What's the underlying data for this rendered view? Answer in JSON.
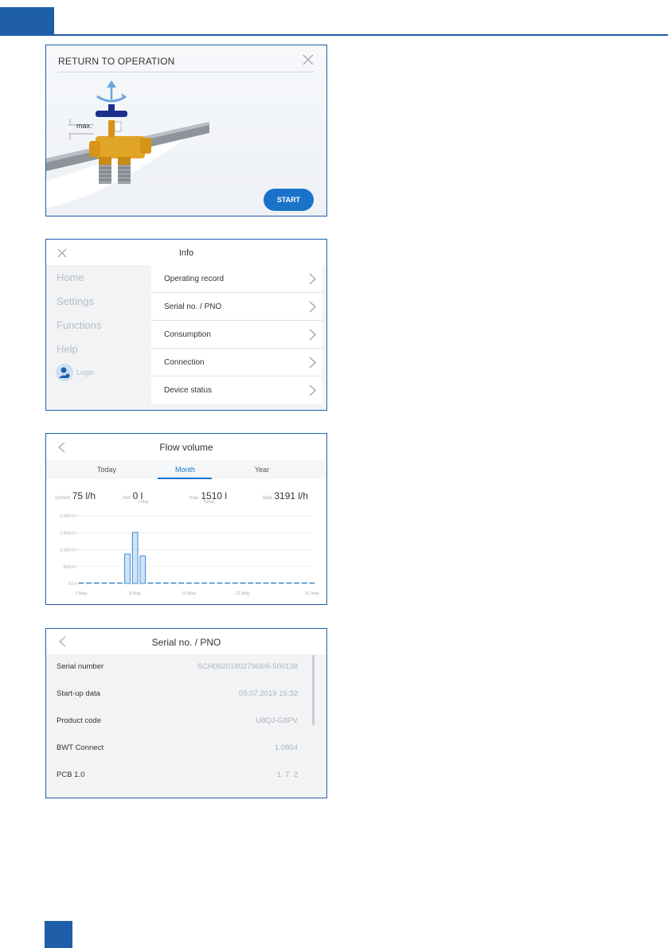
{
  "return_to_operation": {
    "title": "RETURN TO OPERATION",
    "max_label": "max.",
    "start_label": "START"
  },
  "info": {
    "title": "Info",
    "nav": [
      "Home",
      "Settings",
      "Functions",
      "Help"
    ],
    "login_label": "Login",
    "menu": [
      "Operating record",
      "Serial no. / PNO",
      "Consumption",
      "Connection",
      "Device status"
    ]
  },
  "flow": {
    "title": "Flow volume",
    "tabs": [
      "Today",
      "Month",
      "Year"
    ],
    "active_tab": "Month",
    "stats": {
      "current_label": "current",
      "current_value": "75 l/h",
      "min_label": "min",
      "min_value": "0 l",
      "min_date": "1.May",
      "max_label": "max",
      "max_value": "1510 l",
      "max_date": "8.May",
      "total_label": "total",
      "total_value": "3191 l/h"
    }
  },
  "chart_data": {
    "type": "bar",
    "x": [
      1,
      2,
      3,
      4,
      5,
      6,
      7,
      8,
      9,
      10,
      11,
      12,
      13,
      14,
      15,
      16,
      17,
      18,
      19,
      20,
      21,
      22,
      23,
      24,
      25,
      26,
      27,
      28,
      29,
      30,
      31
    ],
    "values": [
      0,
      0,
      0,
      0,
      0,
      0,
      870,
      1510,
      810,
      0,
      0,
      0,
      0,
      0,
      0,
      0,
      0,
      0,
      0,
      0,
      0,
      0,
      0,
      0,
      0,
      0,
      0,
      0,
      0,
      0,
      0
    ],
    "x_tick_labels": [
      "1.May",
      "8.May",
      "15.May",
      "22.May",
      "31.May"
    ],
    "y_tick_labels": [
      "0.0 l",
      "500.0 l",
      "1,000.0 l",
      "1,500.0 l",
      "2,000.0 l"
    ],
    "ylim": [
      0,
      2000
    ],
    "grid": true,
    "colors": {
      "bar_fill": "#cfe4f7",
      "bar_stroke": "#1b73c9"
    }
  },
  "serial": {
    "title": "Serial no. / PNO",
    "rows": [
      {
        "label": "Serial number",
        "value": "SCH062018027968/6-500138"
      },
      {
        "label": "Start-up data",
        "value": "09.07.2019 15:32"
      },
      {
        "label": "Product code",
        "value": "U8QJ-G8PV"
      },
      {
        "label": "BWT Connect",
        "value": "1.0804"
      },
      {
        "label": "PCB 1.0",
        "value": "1. 7. 2"
      }
    ]
  }
}
